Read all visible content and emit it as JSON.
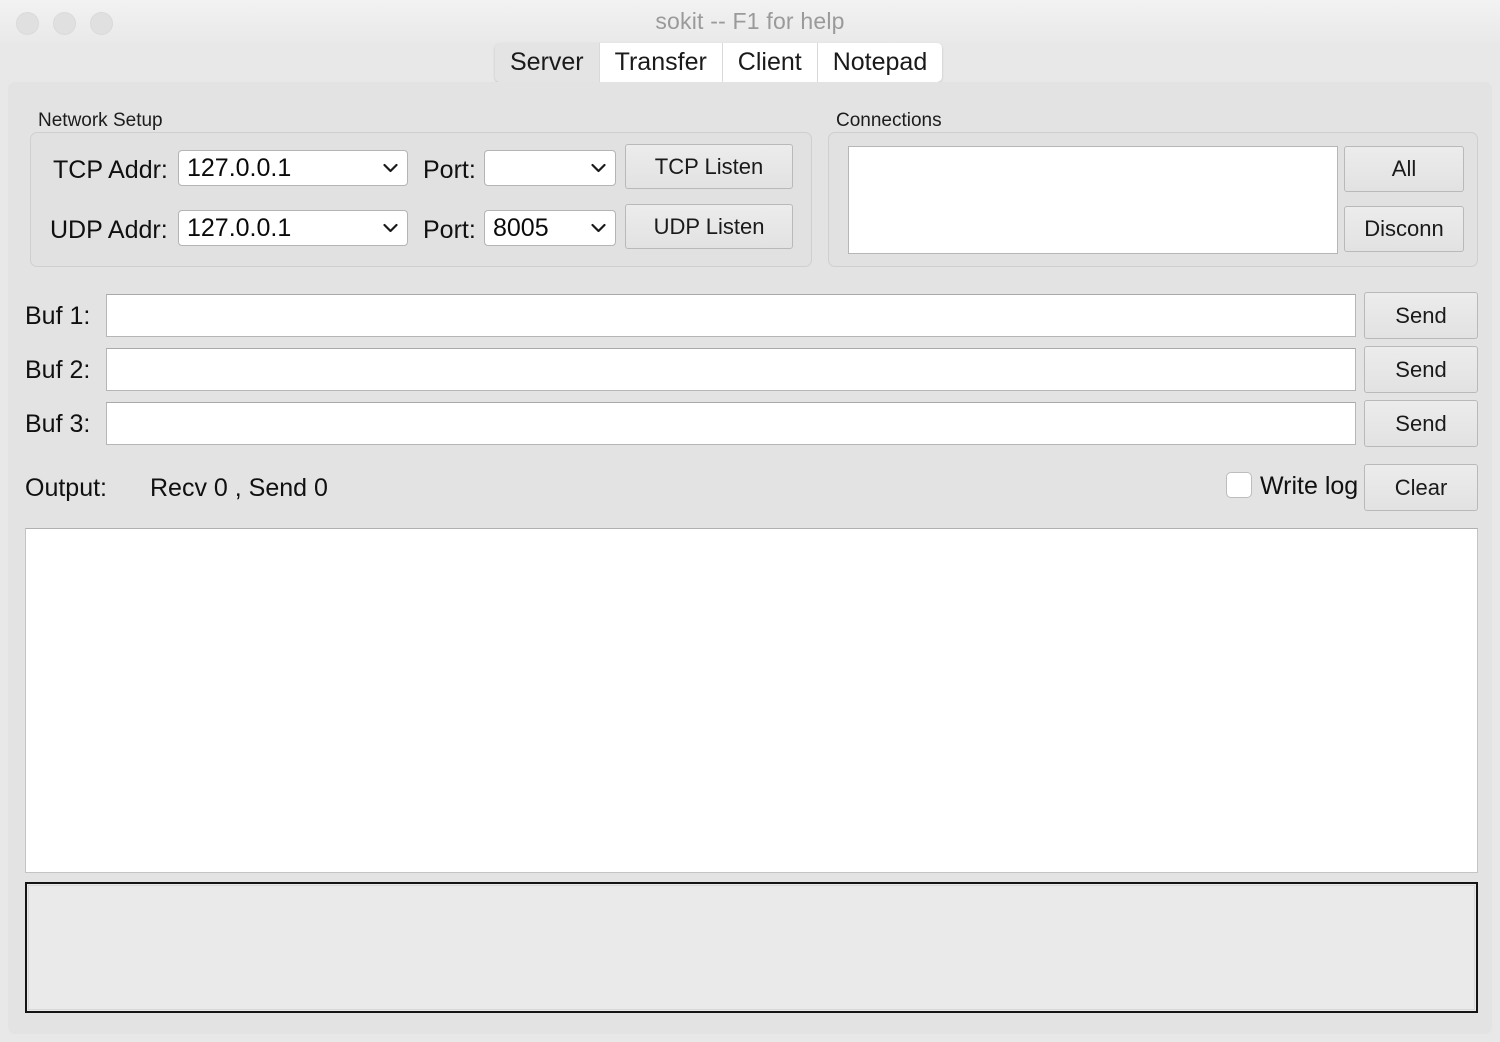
{
  "window": {
    "title": "sokit -- F1 for help",
    "traffic_lights": [
      "close-button",
      "minimize-button",
      "zoom-button"
    ]
  },
  "tabs": [
    {
      "label": "Server",
      "selected": true
    },
    {
      "label": "Transfer",
      "selected": false
    },
    {
      "label": "Client",
      "selected": false
    },
    {
      "label": "Notepad",
      "selected": false
    }
  ],
  "network_setup": {
    "group_label": "Network Setup",
    "tcp": {
      "addr_label": "TCP Addr:",
      "addr_value": "127.0.0.1",
      "port_label": "Port:",
      "port_value": "",
      "listen_button": "TCP Listen"
    },
    "udp": {
      "addr_label": "UDP Addr:",
      "addr_value": "127.0.0.1",
      "port_label": "Port:",
      "port_value": "8005",
      "listen_button": "UDP Listen"
    }
  },
  "connections": {
    "group_label": "Connections",
    "list_items": [],
    "all_button": "All",
    "disconnect_button": "Disconn"
  },
  "buffers": [
    {
      "label": "Buf 1:",
      "value": "",
      "send_label": "Send"
    },
    {
      "label": "Buf 2:",
      "value": "",
      "send_label": "Send"
    },
    {
      "label": "Buf 3:",
      "value": "",
      "send_label": "Send"
    }
  ],
  "output": {
    "label": "Output:",
    "counters": "Recv 0  , Send 0",
    "write_log_label": "Write log",
    "write_log_checked": false,
    "clear_button": "Clear",
    "log_text": "",
    "input_text": ""
  }
}
